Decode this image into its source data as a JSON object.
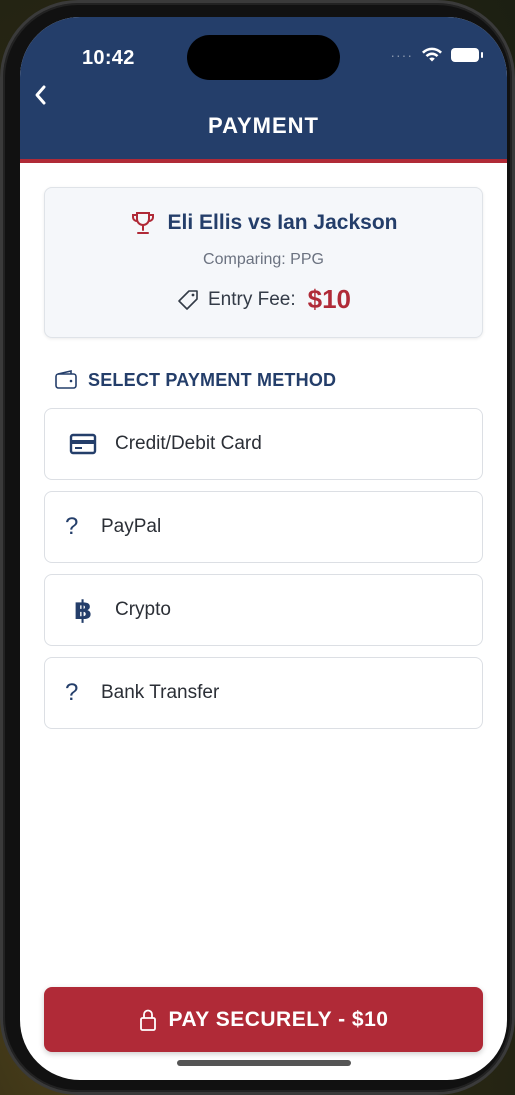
{
  "status_bar": {
    "time": "10:42",
    "signal": "····"
  },
  "header": {
    "title": "PAYMENT"
  },
  "match": {
    "title": "Eli Ellis vs Ian Jackson",
    "comparing": "Comparing: PPG",
    "fee_label": "Entry Fee:",
    "fee_amount": "$10"
  },
  "payment": {
    "section_title": "SELECT PAYMENT METHOD",
    "methods": [
      {
        "label": "Credit/Debit Card",
        "icon": "credit-card-icon"
      },
      {
        "label": "PayPal",
        "icon": "question-icon",
        "glyph": "?"
      },
      {
        "label": "Crypto",
        "icon": "bitcoin-icon",
        "glyph": "฿"
      },
      {
        "label": "Bank Transfer",
        "icon": "question-icon",
        "glyph": "?"
      }
    ]
  },
  "pay_button": {
    "label": "PAY SECURELY - $10",
    "icon": "lock-icon"
  },
  "colors": {
    "primary": "#243e6a",
    "accent": "#b02a37"
  }
}
